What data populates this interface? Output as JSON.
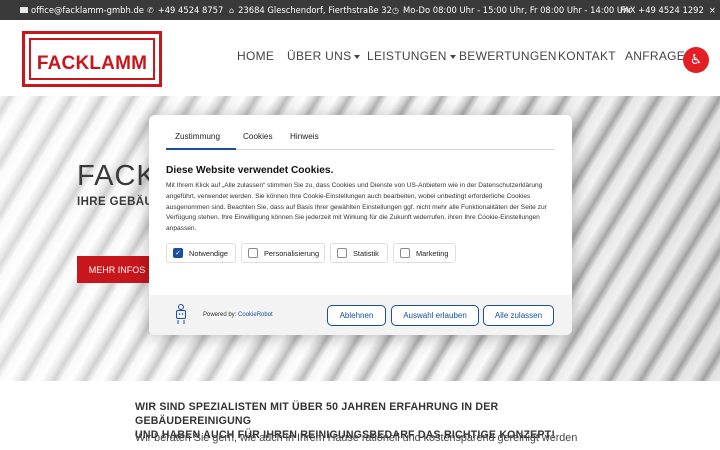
{
  "topbar": {
    "email": "office@facklamm-gmbh.de",
    "phone": "+49 4524 8757",
    "address": "23684 Gleschendorf, Fierthstraße 32",
    "hours": "Mo-Do 08:00 Uhr - 15:00 Uhr, Fr 08:00 Uhr - 14:00 Uhr",
    "fax": "FAX +49 4524 1292",
    "close": "×"
  },
  "logo": {
    "text": "FACKLAMM"
  },
  "nav": {
    "home": "HOME",
    "ueber_uns": "ÜBER UNS",
    "leistungen": "LEISTUNGEN",
    "bewertungen": "BEWERTUNGEN",
    "kontakt": "KONTAKT",
    "anfrage": "ANFRAGE"
  },
  "hero": {
    "title": "FACKL",
    "subtitle": "IHRE GEBÄU",
    "button": "MEHR INFOS"
  },
  "content": {
    "heading_line1": "WIR SIND SPEZIALISTEN MIT ÜBER 50 JAHREN ERFAHRUNG IN DER GEBÄUDEREINIGUNG",
    "heading_line2": "UND HABEN AUCH FÜR IHREN REINIGUNGSBEDARF DAS RICHTIGE KONZEPT!",
    "paragraph": "Wir beraten Sie gern, wie auch in Ihrem Hause rationell und kostensparend gereinigt werden"
  },
  "cookie": {
    "tabs": [
      "Zustimmung",
      "Cookies",
      "Hinweis"
    ],
    "title": "Diese Website verwendet Cookies.",
    "body": "Mit Ihrem Klick auf „Alle zulassen“ stimmen Sie zu, dass Cookies und Dienste von US-Anbietern wie in der Datenschutzerklärung angeführt, verwendet werden. Sie können Ihre Cookie-Einstellungen auch bearbeiten, wobei unbedingt erforderliche Cookies ausgenommen sind. Beachten Sie, dass auf Basis Ihrer gewählten Einstellungen ggf. nicht mehr alle Funktionalitäten der Seite zur Verfügung stehen. Ihre Einwilligung können Sie jederzeit mit Wirkung für die Zukunft widerrufen, ihren Ihre Cookie-Einstellungen anpassen.",
    "options": [
      {
        "label": "Notwendige",
        "checked": true
      },
      {
        "label": "Personalisierung",
        "checked": false
      },
      {
        "label": "Statistik",
        "checked": false
      },
      {
        "label": "Marketing",
        "checked": false
      }
    ],
    "powered_prefix": "Powered by:",
    "powered_brand": "CookieRobot",
    "buttons": {
      "reject": "Ablehnen",
      "selection": "Auswahl erlauben",
      "accept_all": "Alle zulassen"
    }
  },
  "icons": {
    "mail": "mail-icon",
    "phone": "phone-icon",
    "home": "home-icon",
    "clock": "clock-icon",
    "accessibility": "accessibility-icon"
  },
  "colors": {
    "brand_red": "#c8161d",
    "cookie_blue": "#1a4fa0",
    "topbar_bg": "#3a3a3a"
  }
}
